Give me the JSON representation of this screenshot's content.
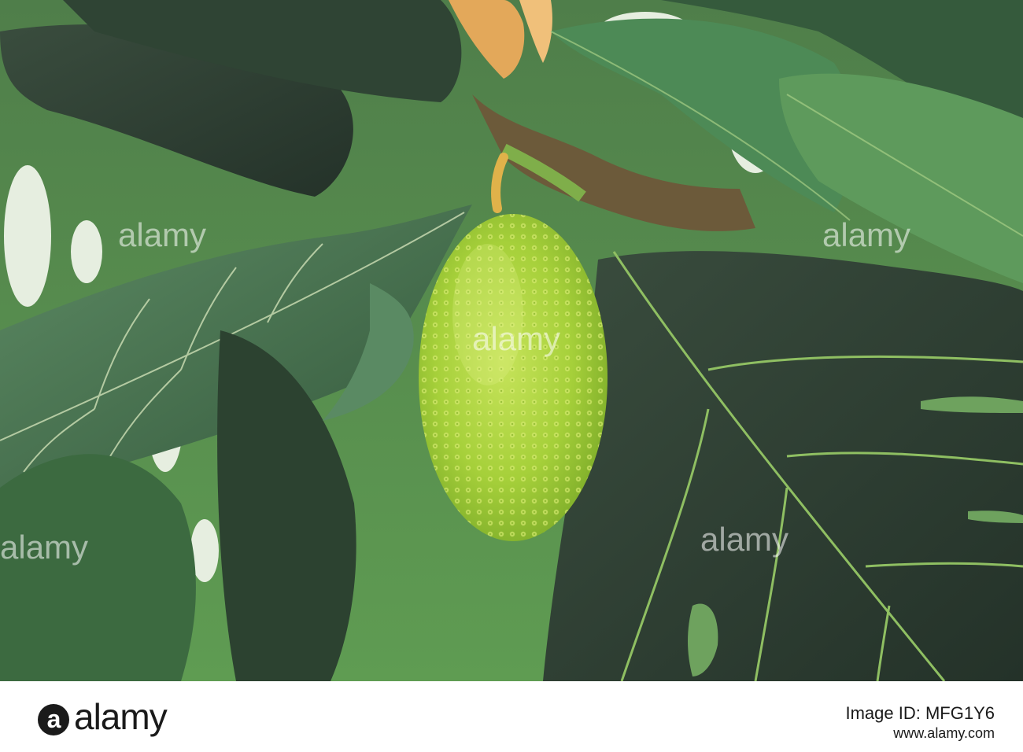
{
  "photo": {
    "watermark_text": "alamy"
  },
  "footer": {
    "logo_text": "alamy",
    "image_id": "Image ID: MFG1Y6",
    "url": "www.alamy.com"
  },
  "colors": {
    "fruit": "#a9d43c",
    "leaf_dark": "#2e3f33",
    "leaf_mid": "#3f6b45",
    "leaf_light": "#6e9c5a",
    "background_bright": "#e8efe4"
  }
}
